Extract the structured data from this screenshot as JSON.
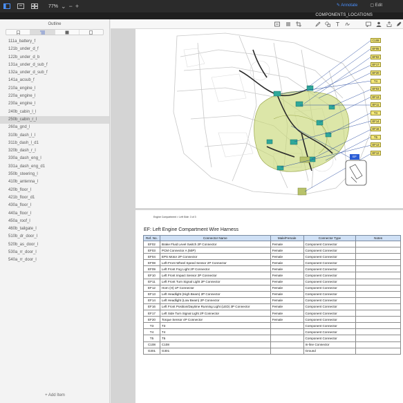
{
  "toolbar": {
    "zoom_value": "77%",
    "zoom_out": "−",
    "zoom_in": "+",
    "annotate_label": "Annotate",
    "edit_label": "Edit",
    "doc_title": "COMPONENTS_LOCATIONS",
    "accent_color": "#4a90ff"
  },
  "sidebar": {
    "title": "Outline",
    "add_item": "+ Add Item",
    "items": [
      "111a_battery_f",
      "121b_under_d_f",
      "122b_under_d_b",
      "131a_under_d_sub_f",
      "132a_under_d_sub_f",
      "141a_acsub_f",
      "210a_engine_l",
      "220a_engine_l",
      "230a_engine_l",
      "240b_cabin_l_l",
      "250b_cabin_r_l",
      "260a_gnd_l",
      "310b_dash_l_l",
      "311b_dash_l_d1",
      "320b_dash_r_l",
      "330a_dash_eng_l",
      "331a_dash_eng_d1",
      "350b_steering_l",
      "410b_antenna_l",
      "420b_floor_l",
      "421b_floor_d1",
      "430a_floor_l",
      "440a_floor_l",
      "450a_roof_l",
      "460b_tailgate_l",
      "510b_dr_door_l",
      "520b_as_door_l",
      "530a_rr_door_l",
      "540a_rr_door_l"
    ],
    "selected_index": 10
  },
  "diagram": {
    "connector_labels": [
      "C108",
      "EF05",
      "EF02",
      "EF17",
      "EF20",
      "T4",
      "EF03",
      "EF13",
      "EF11",
      "T4",
      "EF14",
      "EF16",
      "T5",
      "EF13",
      "EF12"
    ],
    "harness_tag": "EF"
  },
  "page2": {
    "breadcrumb": "Engine Compartment > Left Side: 3 of 3",
    "title": "EF: Left Engine Compartment Wire Harness",
    "headers": [
      "Ref. No.",
      "Connector Name",
      "Male/Female",
      "Connector Type",
      "Notes"
    ],
    "rows": [
      [
        "EF02",
        "Brake Fluid Level Switch 2P Connector",
        "Female",
        "Component Connector",
        ""
      ],
      [
        "EF03",
        "PCM Connector A (50P)",
        "Female",
        "Component Connector",
        ""
      ],
      [
        "EF04",
        "EPS Motor 2P Connector",
        "Female",
        "Component Connector",
        ""
      ],
      [
        "EF08",
        "Left-Front Wheel Speed Sensor 2P Connector",
        "Female",
        "Component Connector",
        ""
      ],
      [
        "EF09",
        "Left Front Fog Light 2P Connector",
        "Female",
        "Component Connector",
        ""
      ],
      [
        "EF10",
        "Left Front Impact Sensor 2P Connector",
        "Female",
        "Component Connector",
        ""
      ],
      [
        "EF11",
        "Left Front Turn Signal Light 2P Connector",
        "Female",
        "Component Connector",
        ""
      ],
      [
        "EF12",
        "Horn (H) 1P Connector",
        "Female",
        "Component Connector",
        ""
      ],
      [
        "EF13",
        "Left Headlight (High Beam) 2P Connector",
        "Female",
        "Component Connector",
        ""
      ],
      [
        "EF14",
        "Left Headlight (Low Beam) 2P Connector",
        "Female",
        "Component Connector",
        ""
      ],
      [
        "EF16",
        "Left Front Position/Daytime Running Light (LED) 3P Connector",
        "Female",
        "Component Connector",
        ""
      ],
      [
        "EF17",
        "Left Side Turn Signal Light 2P Connector",
        "Female",
        "Component Connector",
        ""
      ],
      [
        "EF20",
        "Torque Sensor 4P Connector",
        "Female",
        "Component Connector",
        ""
      ],
      [
        "T3",
        "T3",
        "",
        "Component Connector",
        ""
      ],
      [
        "T4",
        "T4",
        "",
        "Component Connector",
        ""
      ],
      [
        "T5",
        "T5",
        "",
        "Component Connector",
        ""
      ],
      [
        "C108",
        "C108",
        "",
        "In-line Connector",
        ""
      ],
      [
        "G301",
        "G301",
        "",
        "Ground",
        ""
      ]
    ]
  }
}
